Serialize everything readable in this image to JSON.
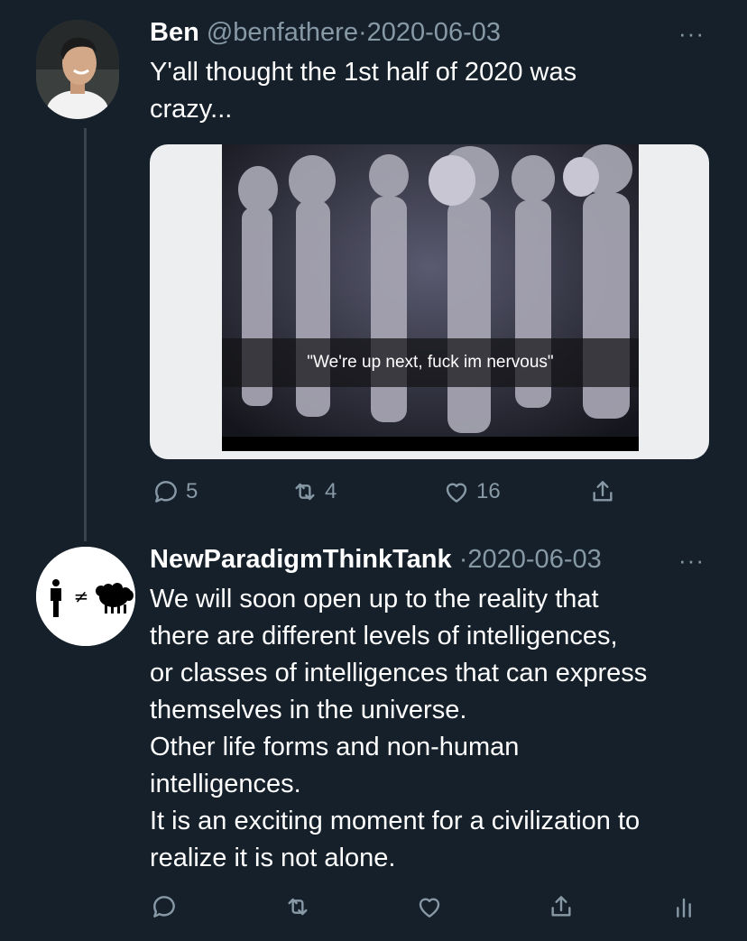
{
  "tweet1": {
    "name": "Ben",
    "handle": "@benfathere",
    "separator": "·",
    "date": "2020-06-03",
    "more": "···",
    "text_lines": [
      "Y'all thought the 1st half of 2020 was",
      "crazy..."
    ],
    "image_caption": "\"We're up next, fuck im nervous\"",
    "replies": "5",
    "retweets": "4",
    "likes": "16"
  },
  "tweet2": {
    "name": "NewParadigmThinkTank",
    "separator": "·",
    "date": "2020-06-03",
    "more": "···",
    "text_lines": [
      "We will soon open up to the reality that",
      "there are different levels of intelligences,",
      "or classes of intelligences that can express",
      "themselves in the universe.",
      "Other life forms and non-human",
      "intelligences.",
      "It is an exciting moment for a civilization to",
      "realize it is not alone."
    ],
    "avatar_symbol": "≠"
  },
  "icons": {
    "reply": "reply-icon",
    "retweet": "retweet-icon",
    "like": "heart-icon",
    "share": "share-icon",
    "analytics": "analytics-icon"
  },
  "colors": {
    "background": "#15202b",
    "muted": "#8899a6",
    "thread_line": "#38444d"
  }
}
